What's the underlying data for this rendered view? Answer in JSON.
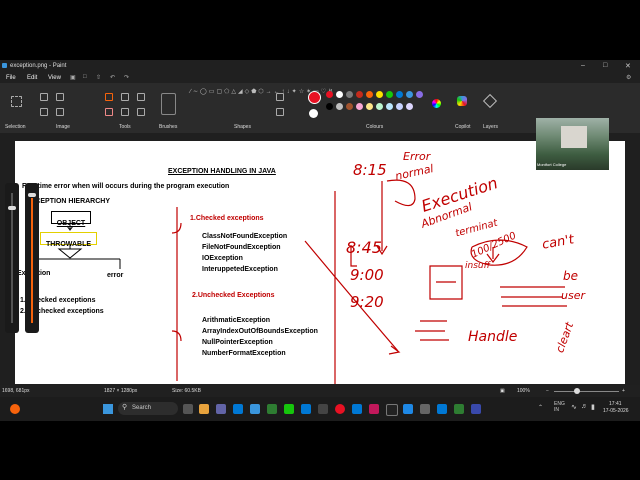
{
  "window": {
    "title": "exception.png - Paint"
  },
  "menu": [
    "File",
    "Edit",
    "View"
  ],
  "ribbon_groups": {
    "selection": "Selection",
    "image": "Image",
    "tools": "Tools",
    "brushes": "Brushes",
    "shapes": "Shapes",
    "colours": "Colours",
    "copilot": "Copilot",
    "layers": "Layers"
  },
  "palette": [
    "#e81123",
    "#ffffff",
    "#7a7a7a",
    "#c42b1c",
    "#f7630c",
    "#fce100",
    "#16c60c",
    "#0078d4",
    "#3a96dd",
    "#886ce4",
    "#000000",
    "#c0c0c0",
    "#a0522d",
    "#f9a8d4",
    "#fde68a",
    "#bbf7d0",
    "#bae6fd",
    "#c7d2fe",
    "#ddd6fe"
  ],
  "webcam": {
    "label": "Montfort College"
  },
  "doc": {
    "title": "EXCEPTION HANDLING IN JAVA",
    "definition": "Run time error when will occurs during the program execution",
    "hierarchy_heading": "EXCEPTION HIERARCHY",
    "box_object": "OBJECT",
    "box_throwable": "THROWABLE",
    "label_exception": "Exception",
    "label_error": "error",
    "list_checked": "1. Checked exceptions",
    "list_unchecked": "2. Unchecked exceptions",
    "checked_heading": "1.Checked exceptions",
    "checked_items": [
      "ClassNotFoundException",
      "FileNotFoundException",
      "IOException",
      "InteruppetedException"
    ],
    "unchecked_heading": "2.Unchecked Exceptions",
    "unchecked_items": [
      "ArithmaticException",
      "ArrayIndexOutOfBoundsException",
      "NullPointerException",
      "NumberFormatException"
    ]
  },
  "handwriting": {
    "t1": "8:15",
    "t2": "Error",
    "t3": "normal",
    "t4": "Execution",
    "t5": "Abnormal",
    "t6": "terminat",
    "t7": "8:45",
    "t8": "9:00",
    "t9": "9:20",
    "t10": "100/2500",
    "t11": "insuff",
    "t12": "can't",
    "t13": "be",
    "t14": "user",
    "t15": "Handle",
    "t16": "cleart"
  },
  "status": {
    "cursor": "1698, 681px",
    "dimensions": "1827 × 1280px",
    "size": "Size: 60.5KB",
    "zoom": "100%"
  },
  "taskbar": {
    "search_placeholder": "Search",
    "lang": "ENG\nIN",
    "time": "17:41",
    "date": "17-05-2026"
  }
}
